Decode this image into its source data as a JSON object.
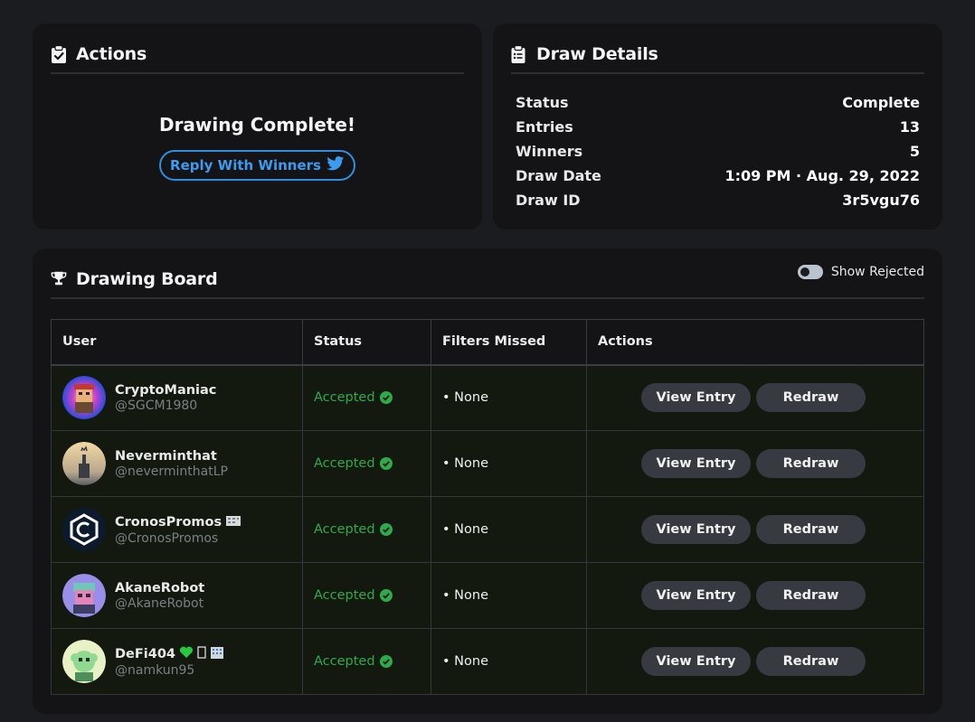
{
  "actions_card": {
    "title": "Actions",
    "icon": "clipboard-check-icon",
    "message": "Drawing Complete!",
    "reply_button": "Reply With Winners",
    "reply_icon": "twitter-icon"
  },
  "details_card": {
    "title": "Draw Details",
    "icon": "clipboard-list-icon",
    "rows": [
      {
        "label": "Status",
        "value": "Complete"
      },
      {
        "label": "Entries",
        "value": "13"
      },
      {
        "label": "Winners",
        "value": "5"
      },
      {
        "label": "Draw Date",
        "value": "1:09 PM · Aug. 29, 2022"
      },
      {
        "label": "Draw ID",
        "value": "3r5vgu76"
      }
    ]
  },
  "board": {
    "title": "Drawing Board",
    "icon": "trophy-icon",
    "toggle_label": "Show Rejected",
    "toggle_on": false,
    "columns": [
      "User",
      "Status",
      "Filters Missed",
      "Actions"
    ],
    "rows": [
      {
        "name": "CryptoManiac",
        "handle": "@SGCM1980",
        "status": "Accepted",
        "filters": "• None",
        "view": "View Entry",
        "redraw": "Redraw"
      },
      {
        "name": "Neverminthat",
        "handle": "@neverminthatLP",
        "status": "Accepted",
        "filters": "• None",
        "view": "View Entry",
        "redraw": "Redraw"
      },
      {
        "name": "CronosPromos",
        "handle": "@CronosPromos",
        "status": "Accepted",
        "filters": "• None",
        "view": "View Entry",
        "redraw": "Redraw"
      },
      {
        "name": "AkaneRobot",
        "handle": "@AkaneRobot",
        "status": "Accepted",
        "filters": "• None",
        "view": "View Entry",
        "redraw": "Redraw"
      },
      {
        "name": "DeFi404",
        "handle": "@namkun95",
        "status": "Accepted",
        "filters": "• None",
        "view": "View Entry",
        "redraw": "Redraw"
      }
    ]
  },
  "colors": {
    "background": "#1b1c1f",
    "card": "#141416",
    "accent_blue": "#2d8fe0",
    "accepted_green": "#2faa4b",
    "row_bg": "#13190f",
    "button_bg": "#383a41"
  }
}
